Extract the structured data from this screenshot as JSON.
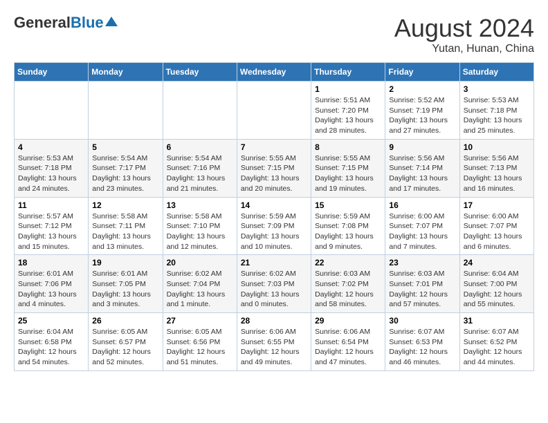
{
  "header": {
    "logo_general": "General",
    "logo_blue": "Blue",
    "month": "August 2024",
    "location": "Yutan, Hunan, China"
  },
  "days_of_week": [
    "Sunday",
    "Monday",
    "Tuesday",
    "Wednesday",
    "Thursday",
    "Friday",
    "Saturday"
  ],
  "weeks": [
    {
      "days": [
        {
          "num": "",
          "info": ""
        },
        {
          "num": "",
          "info": ""
        },
        {
          "num": "",
          "info": ""
        },
        {
          "num": "",
          "info": ""
        },
        {
          "num": "1",
          "info": "Sunrise: 5:51 AM\nSunset: 7:20 PM\nDaylight: 13 hours\nand 28 minutes."
        },
        {
          "num": "2",
          "info": "Sunrise: 5:52 AM\nSunset: 7:19 PM\nDaylight: 13 hours\nand 27 minutes."
        },
        {
          "num": "3",
          "info": "Sunrise: 5:53 AM\nSunset: 7:18 PM\nDaylight: 13 hours\nand 25 minutes."
        }
      ]
    },
    {
      "days": [
        {
          "num": "4",
          "info": "Sunrise: 5:53 AM\nSunset: 7:18 PM\nDaylight: 13 hours\nand 24 minutes."
        },
        {
          "num": "5",
          "info": "Sunrise: 5:54 AM\nSunset: 7:17 PM\nDaylight: 13 hours\nand 23 minutes."
        },
        {
          "num": "6",
          "info": "Sunrise: 5:54 AM\nSunset: 7:16 PM\nDaylight: 13 hours\nand 21 minutes."
        },
        {
          "num": "7",
          "info": "Sunrise: 5:55 AM\nSunset: 7:15 PM\nDaylight: 13 hours\nand 20 minutes."
        },
        {
          "num": "8",
          "info": "Sunrise: 5:55 AM\nSunset: 7:15 PM\nDaylight: 13 hours\nand 19 minutes."
        },
        {
          "num": "9",
          "info": "Sunrise: 5:56 AM\nSunset: 7:14 PM\nDaylight: 13 hours\nand 17 minutes."
        },
        {
          "num": "10",
          "info": "Sunrise: 5:56 AM\nSunset: 7:13 PM\nDaylight: 13 hours\nand 16 minutes."
        }
      ]
    },
    {
      "days": [
        {
          "num": "11",
          "info": "Sunrise: 5:57 AM\nSunset: 7:12 PM\nDaylight: 13 hours\nand 15 minutes."
        },
        {
          "num": "12",
          "info": "Sunrise: 5:58 AM\nSunset: 7:11 PM\nDaylight: 13 hours\nand 13 minutes."
        },
        {
          "num": "13",
          "info": "Sunrise: 5:58 AM\nSunset: 7:10 PM\nDaylight: 13 hours\nand 12 minutes."
        },
        {
          "num": "14",
          "info": "Sunrise: 5:59 AM\nSunset: 7:09 PM\nDaylight: 13 hours\nand 10 minutes."
        },
        {
          "num": "15",
          "info": "Sunrise: 5:59 AM\nSunset: 7:08 PM\nDaylight: 13 hours\nand 9 minutes."
        },
        {
          "num": "16",
          "info": "Sunrise: 6:00 AM\nSunset: 7:07 PM\nDaylight: 13 hours\nand 7 minutes."
        },
        {
          "num": "17",
          "info": "Sunrise: 6:00 AM\nSunset: 7:07 PM\nDaylight: 13 hours\nand 6 minutes."
        }
      ]
    },
    {
      "days": [
        {
          "num": "18",
          "info": "Sunrise: 6:01 AM\nSunset: 7:06 PM\nDaylight: 13 hours\nand 4 minutes."
        },
        {
          "num": "19",
          "info": "Sunrise: 6:01 AM\nSunset: 7:05 PM\nDaylight: 13 hours\nand 3 minutes."
        },
        {
          "num": "20",
          "info": "Sunrise: 6:02 AM\nSunset: 7:04 PM\nDaylight: 13 hours\nand 1 minute."
        },
        {
          "num": "21",
          "info": "Sunrise: 6:02 AM\nSunset: 7:03 PM\nDaylight: 13 hours\nand 0 minutes."
        },
        {
          "num": "22",
          "info": "Sunrise: 6:03 AM\nSunset: 7:02 PM\nDaylight: 12 hours\nand 58 minutes."
        },
        {
          "num": "23",
          "info": "Sunrise: 6:03 AM\nSunset: 7:01 PM\nDaylight: 12 hours\nand 57 minutes."
        },
        {
          "num": "24",
          "info": "Sunrise: 6:04 AM\nSunset: 7:00 PM\nDaylight: 12 hours\nand 55 minutes."
        }
      ]
    },
    {
      "days": [
        {
          "num": "25",
          "info": "Sunrise: 6:04 AM\nSunset: 6:58 PM\nDaylight: 12 hours\nand 54 minutes."
        },
        {
          "num": "26",
          "info": "Sunrise: 6:05 AM\nSunset: 6:57 PM\nDaylight: 12 hours\nand 52 minutes."
        },
        {
          "num": "27",
          "info": "Sunrise: 6:05 AM\nSunset: 6:56 PM\nDaylight: 12 hours\nand 51 minutes."
        },
        {
          "num": "28",
          "info": "Sunrise: 6:06 AM\nSunset: 6:55 PM\nDaylight: 12 hours\nand 49 minutes."
        },
        {
          "num": "29",
          "info": "Sunrise: 6:06 AM\nSunset: 6:54 PM\nDaylight: 12 hours\nand 47 minutes."
        },
        {
          "num": "30",
          "info": "Sunrise: 6:07 AM\nSunset: 6:53 PM\nDaylight: 12 hours\nand 46 minutes."
        },
        {
          "num": "31",
          "info": "Sunrise: 6:07 AM\nSunset: 6:52 PM\nDaylight: 12 hours\nand 44 minutes."
        }
      ]
    }
  ]
}
